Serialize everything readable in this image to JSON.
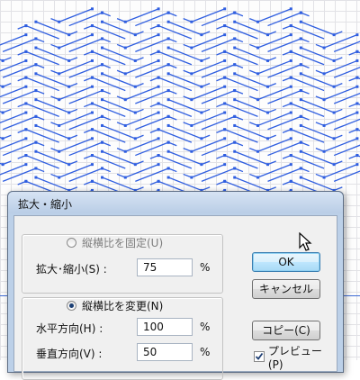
{
  "dialog": {
    "title": "拡大・縮小",
    "uniform": {
      "label": "縦横比を固定(U)",
      "selected": false,
      "scale_label": "拡大･縮小(S) :",
      "scale_value": "75",
      "unit": "%"
    },
    "non_uniform": {
      "label": "縦横比を変更(N)",
      "selected": true,
      "horizontal_label": "水平方向(H) :",
      "horizontal_value": "100",
      "vertical_label": "垂直方向(V) :",
      "vertical_value": "50",
      "unit": "%"
    },
    "buttons": {
      "ok": "OK",
      "cancel": "キャンセル",
      "copy": "コピー(C)"
    },
    "preview": {
      "label": "プレビュー(P)",
      "checked": true
    }
  },
  "colors": {
    "artwork_stroke": "#2f5ee0",
    "guide": "#3e6bd6",
    "grid": "#e2e2e6"
  }
}
